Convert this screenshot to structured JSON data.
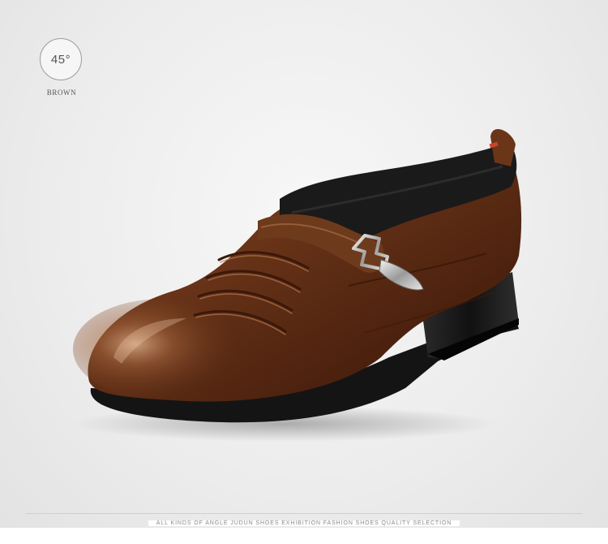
{
  "badge": {
    "angle": "45°",
    "color_name": "BROWN"
  },
  "product": {
    "icon": "brown-leather-slip-on-shoe-with-buckle-icon"
  },
  "footer": {
    "tagline": "ALL KINDS OF ANGLE JUDUN SHOES EXHIBITION FASHION SHOES QUALITY SELECTION"
  },
  "colors": {
    "leather": "#5a2a12",
    "leather_highlight": "#a46a45",
    "sole": "#151515",
    "collar": "#1c1c1c",
    "background": "#ececec"
  }
}
